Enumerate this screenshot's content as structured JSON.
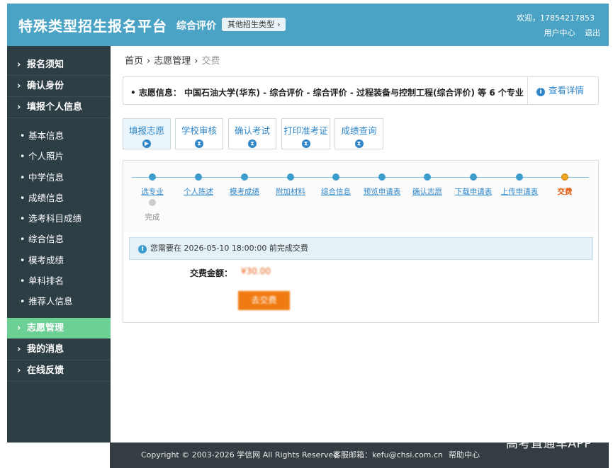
{
  "header": {
    "brand": "特殊类型招生报名平台",
    "subtitle": "综合评价",
    "other_type": "其他招生类型",
    "welcome": "欢迎，17854217853",
    "user_center": "用户中心",
    "logout": "退出"
  },
  "sidebar": {
    "top_items": [
      {
        "label": "报名须知"
      },
      {
        "label": "确认身份"
      },
      {
        "label": "填报个人信息"
      }
    ],
    "sub_items": [
      {
        "label": "基本信息"
      },
      {
        "label": "个人照片"
      },
      {
        "label": "中学信息"
      },
      {
        "label": "成绩信息"
      },
      {
        "label": "选考科目成绩"
      },
      {
        "label": "综合信息"
      },
      {
        "label": "模考成绩"
      },
      {
        "label": "单科排名"
      },
      {
        "label": "推荐人信息"
      }
    ],
    "bottom_items": [
      {
        "label": "志愿管理",
        "active": true
      },
      {
        "label": "我的消息"
      },
      {
        "label": "在线反馈"
      }
    ]
  },
  "breadcrumb": {
    "home": "首页",
    "section": "志愿管理",
    "current": "交费"
  },
  "info_bar": {
    "text": "志愿信息：  中国石油大学(华东) - 综合评价 - 综合评价 - 过程装备与控制工程(综合评价) 等 6 个专业",
    "detail_link": "查看详情"
  },
  "tabs": [
    {
      "label": "填报志愿",
      "active": true
    },
    {
      "label": "学校审核"
    },
    {
      "label": "确认考试"
    },
    {
      "label": "打印准考证"
    },
    {
      "label": "成绩查询"
    }
  ],
  "steps": [
    {
      "label": "选专业",
      "state": "done"
    },
    {
      "label": "个人陈述",
      "state": "done"
    },
    {
      "label": "模考成绩",
      "state": "done"
    },
    {
      "label": "附加材料",
      "state": "done"
    },
    {
      "label": "综合信息",
      "state": "done"
    },
    {
      "label": "预览申请表",
      "state": "done"
    },
    {
      "label": "确认志愿",
      "state": "done"
    },
    {
      "label": "下载申请表",
      "state": "done"
    },
    {
      "label": "上传申请表",
      "state": "done"
    },
    {
      "label": "交费",
      "state": "current"
    },
    {
      "label": "完成",
      "state": "pending"
    }
  ],
  "notice": "您需要在 2026-05-10 18:00:00 前完成交费",
  "fee": {
    "label": "交费金额：",
    "amount": "¥30.00",
    "pay_button": "去交费"
  },
  "footer": {
    "copyright": "Copyright © 2003-2026 学信网 All Rights Reserved",
    "email": "客服邮箱：kefu@chsi.com.cn",
    "help": "帮助中心"
  },
  "watermark": "高考直通车APP",
  "colors": {
    "header": "#4aa3c4",
    "sidebar": "#2d3e45",
    "sidebar_active": "#6ccf94",
    "link": "#2f86c9",
    "accent": "#f07b12"
  }
}
